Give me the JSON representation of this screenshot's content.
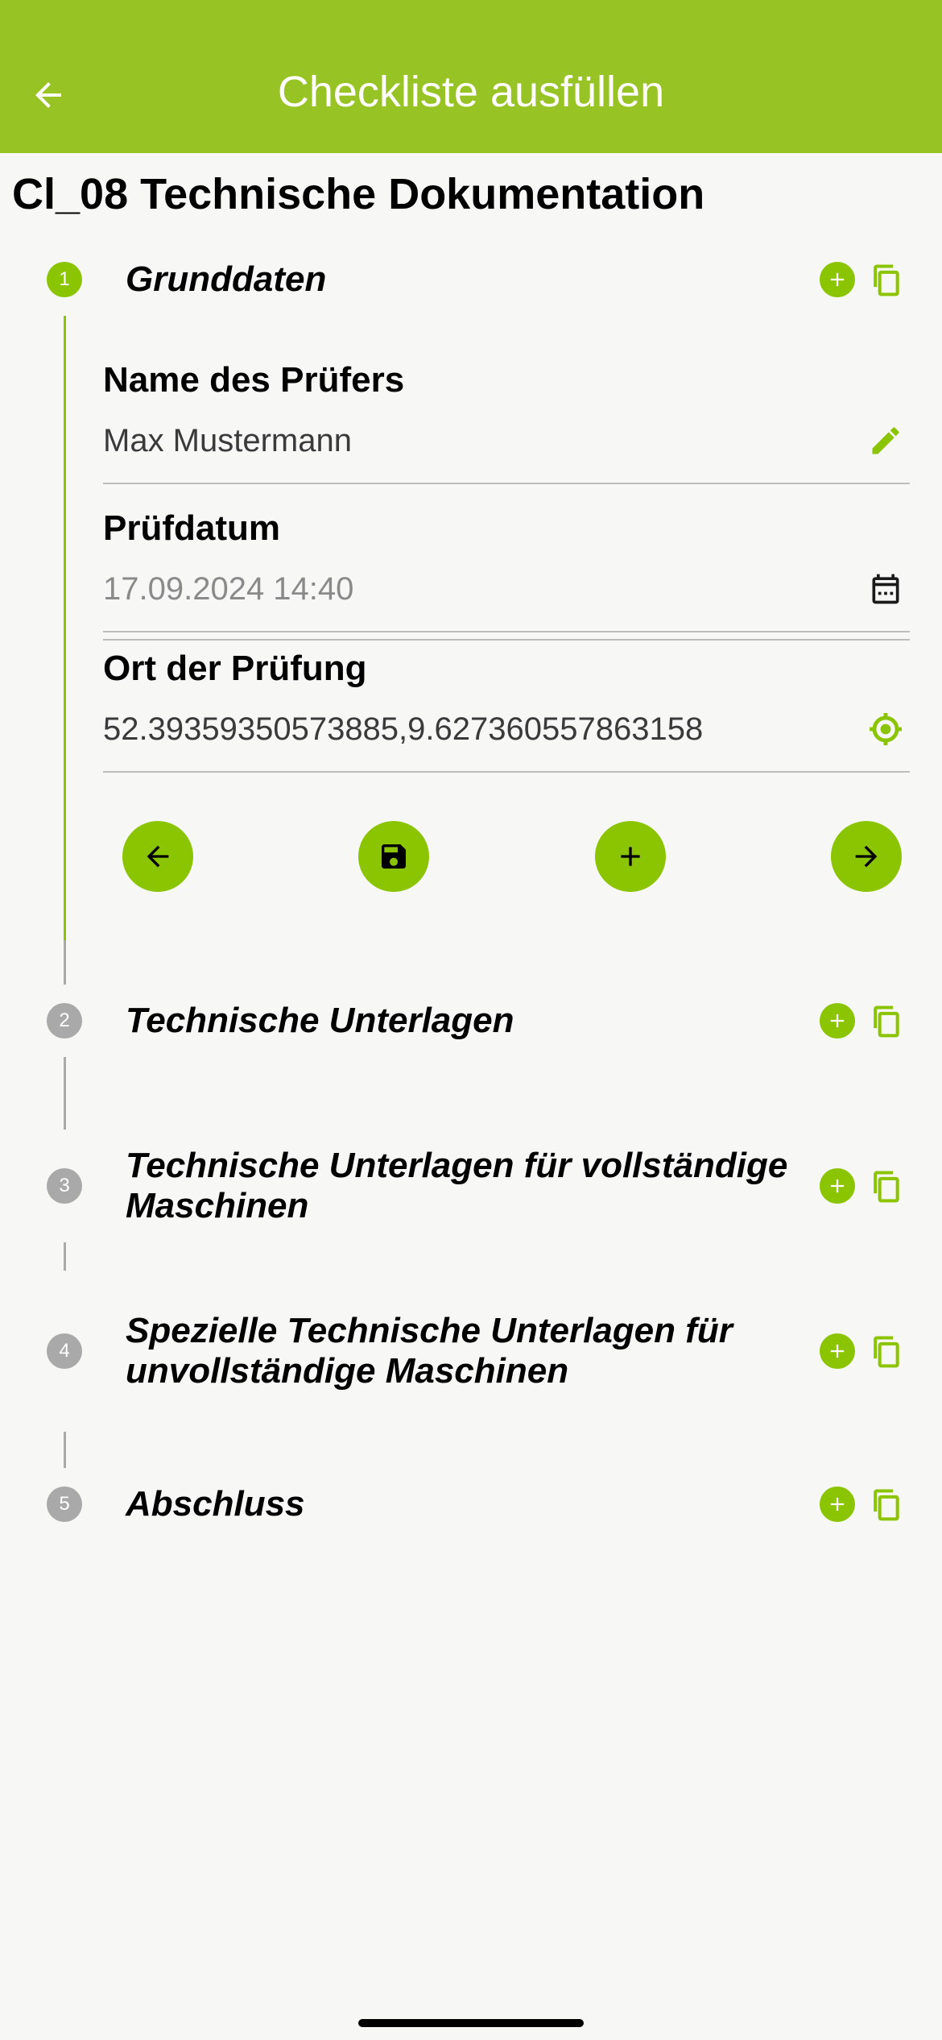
{
  "header": {
    "title": "Checkliste ausfüllen"
  },
  "page": {
    "title": "Cl_08 Technische Dokumentation"
  },
  "steps": [
    {
      "num": "1",
      "title": "Grunddaten"
    },
    {
      "num": "2",
      "title": "Technische Unterlagen"
    },
    {
      "num": "3",
      "title": "Technische Unterlagen für vollständige Maschinen"
    },
    {
      "num": "4",
      "title": "Spezielle Technische Unterlagen für unvollständige Maschinen"
    },
    {
      "num": "5",
      "title": "Abschluss"
    }
  ],
  "fields": {
    "inspector": {
      "label": "Name des Prüfers",
      "value": "Max Mustermann"
    },
    "date": {
      "label": "Prüfdatum",
      "value": "17.09.2024 14:40"
    },
    "location": {
      "label": "Ort der Prüfung",
      "value": "52.39359350573885,9.627360557863158"
    }
  },
  "colors": {
    "accent": "#8bc400",
    "inactive": "#a9a9a9"
  }
}
